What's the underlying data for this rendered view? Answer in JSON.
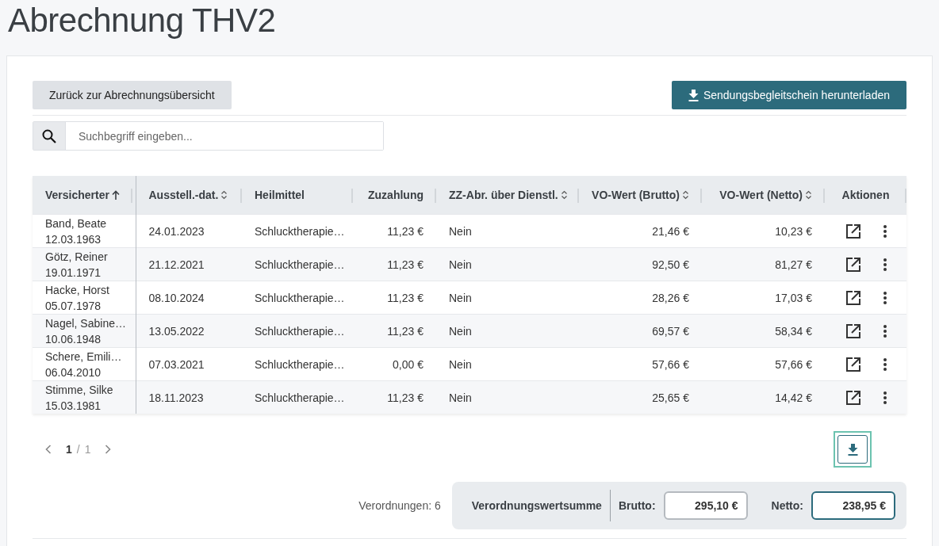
{
  "page_title": "Abrechnung THV2",
  "back_button": "Zurück zur Abrechnungsübersicht",
  "download_button": "Sendungsbegleitschein herunterladen",
  "search": {
    "placeholder": "Suchbegriff eingeben..."
  },
  "table": {
    "columns": [
      {
        "label": "Versicherter",
        "sorted": true
      },
      {
        "label": "Ausstell.-dat.",
        "sorted": false
      },
      {
        "label": "Heilmittel"
      },
      {
        "label": "Zuzahlung"
      },
      {
        "label": "ZZ-Abr. über Dienstl.",
        "sorted": false
      },
      {
        "label": "VO-Wert (Brutto)",
        "sorted": false
      },
      {
        "label": "VO-Wert (Netto)",
        "sorted": false
      },
      {
        "label": "Aktionen"
      }
    ],
    "rows": [
      {
        "name": "Band, Beate",
        "birth": "12.03.1963",
        "date": "24.01.2023",
        "remedy": "Schlucktherapie…",
        "copay": "11,23 €",
        "via_provider": "Nein",
        "gross": "21,46 €",
        "net": "10,23 €"
      },
      {
        "name": "Götz, Reiner",
        "birth": "19.01.1971",
        "date": "21.12.2021",
        "remedy": "Schlucktherapie…",
        "copay": "11,23 €",
        "via_provider": "Nein",
        "gross": "92,50 €",
        "net": "81,27 €"
      },
      {
        "name": "Hacke, Horst",
        "birth": "05.07.1978",
        "date": "08.10.2024",
        "remedy": "Schlucktherapie…",
        "copay": "11,23 €",
        "via_provider": "Nein",
        "gross": "28,26 €",
        "net": "17,03 €"
      },
      {
        "name": "Nagel, Sabine…",
        "birth": "10.06.1948",
        "date": "13.05.2022",
        "remedy": "Schlucktherapie…",
        "copay": "11,23 €",
        "via_provider": "Nein",
        "gross": "69,57 €",
        "net": "58,34 €"
      },
      {
        "name": "Schere, Emili…",
        "birth": "06.04.2010",
        "date": "07.03.2021",
        "remedy": "Schlucktherapie…",
        "copay": "0,00 €",
        "via_provider": "Nein",
        "gross": "57,66 €",
        "net": "57,66 €"
      },
      {
        "name": "Stimme, Silke",
        "birth": "15.03.1981",
        "date": "18.11.2023",
        "remedy": "Schlucktherapie…",
        "copay": "11,23 €",
        "via_provider": "Nein",
        "gross": "25,65 €",
        "net": "14,42 €"
      }
    ]
  },
  "pagination": {
    "current": "1",
    "separator": "/",
    "total": "1"
  },
  "export_button": {
    "focused": true
  },
  "footer": {
    "count_label": "Verordnungen: 6",
    "sum_label": "Verordnungswertsumme",
    "totals": [
      {
        "label": "Brutto:",
        "value": "295,10 €",
        "focused": false
      },
      {
        "label": "Netto:",
        "value": "238,95 €",
        "focused": true
      }
    ]
  }
}
